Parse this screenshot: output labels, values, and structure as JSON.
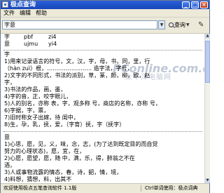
{
  "window": {
    "title": "极点查询"
  },
  "menu": {
    "file": "文件",
    "edit": "编辑",
    "help": "帮助"
  },
  "toolbar": {
    "query_value": "字意",
    "query_button": "查询"
  },
  "codes": {
    "rows": [
      {
        "char": "字",
        "code1": "pbf",
        "code2": "zi4"
      },
      {
        "char": "意",
        "code1": "ujmu",
        "code2": "yi4"
      }
    ]
  },
  "watermark": {
    "logo": "PConline.com.cn",
    "sub": "太平洋电脑网"
  },
  "definitions": {
    "zi": {
      "head": "字",
      "lines": [
        "1)用来记录语言的符号，文，汉，字，母，书，同，里，行",
        "（hàn zuì）根，…………………… 造字法，字号，",
        "2)文字的不同形式，书法的派别，草，篆，颜，柳，欧，赵",
        "字，",
        "3)书法的作品，画，墨，",
        "4)字的音，正，咬字眼儿，",
        "5)人的别名，亦称 表，字，观多称 号，商店的名称，亦称 号，",
        "6)字据，字，票，",
        "7)旧时称女子出嫁，待 闺中，",
        "8)生，孕，乳，抚，爱，（字育）抚，字（抚字）"
      ]
    },
    "yi": {
      "head": "意",
      "lines": [
        "1)心思，愿，见，义，味，念，志，(为了达到既定目的而自觉",
        "努力的心理状态)，愿，宜，在，",
        "2)心愿，愿望，愿，随 中，满，乐，得，醉翁之不在",
        "酒，",
        "3)人或事物流露的情态，春，诗，韶，情，境，",
        "4)料想，猜想，料，出其不"
      ]
    }
  },
  "status": {
    "left": "欢迎使用极点五笔查询软件 1.1版",
    "right": "Ctrl单词使用：极点词典"
  }
}
